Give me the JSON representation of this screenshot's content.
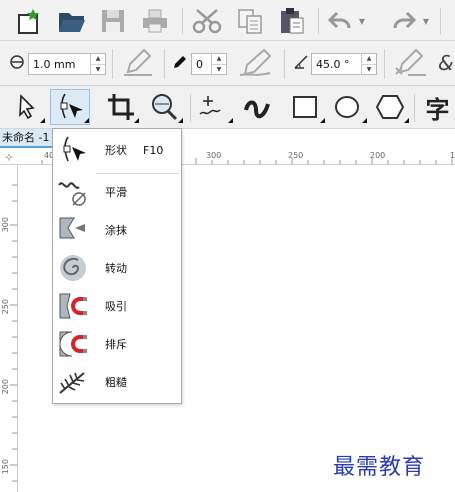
{
  "toolbar_standard": {
    "items": [
      "new-document",
      "open-folder",
      "save",
      "print",
      "cut",
      "copy",
      "paste",
      "undo",
      "redo"
    ]
  },
  "property_bar": {
    "nudge_distance": "1.0 mm",
    "pen_stroke": "0",
    "angle": "45.0 °"
  },
  "document": {
    "tab_title": "未命名 -1"
  },
  "ruler": {
    "top_labels": [
      "40",
      "300",
      "250",
      "200",
      "1"
    ],
    "left_labels": [
      "300",
      "250",
      "200",
      "150"
    ]
  },
  "flyout": {
    "items": [
      {
        "label": "形状",
        "shortcut": "F10",
        "icon": "shape-tool-icon"
      },
      {
        "label": "平滑",
        "icon": "smooth-tool-icon"
      },
      {
        "label": "涂抹",
        "icon": "smear-tool-icon"
      },
      {
        "label": "转动",
        "icon": "twirl-tool-icon"
      },
      {
        "label": "吸引",
        "icon": "attract-tool-icon"
      },
      {
        "label": "排斥",
        "icon": "repel-tool-icon"
      },
      {
        "label": "粗糙",
        "icon": "roughen-tool-icon"
      }
    ]
  },
  "watermark": "最需教育",
  "colors": {
    "accent": "#5aa0d8",
    "watermark": "#2b3bb0",
    "repel_magnet": "#d9232d"
  }
}
